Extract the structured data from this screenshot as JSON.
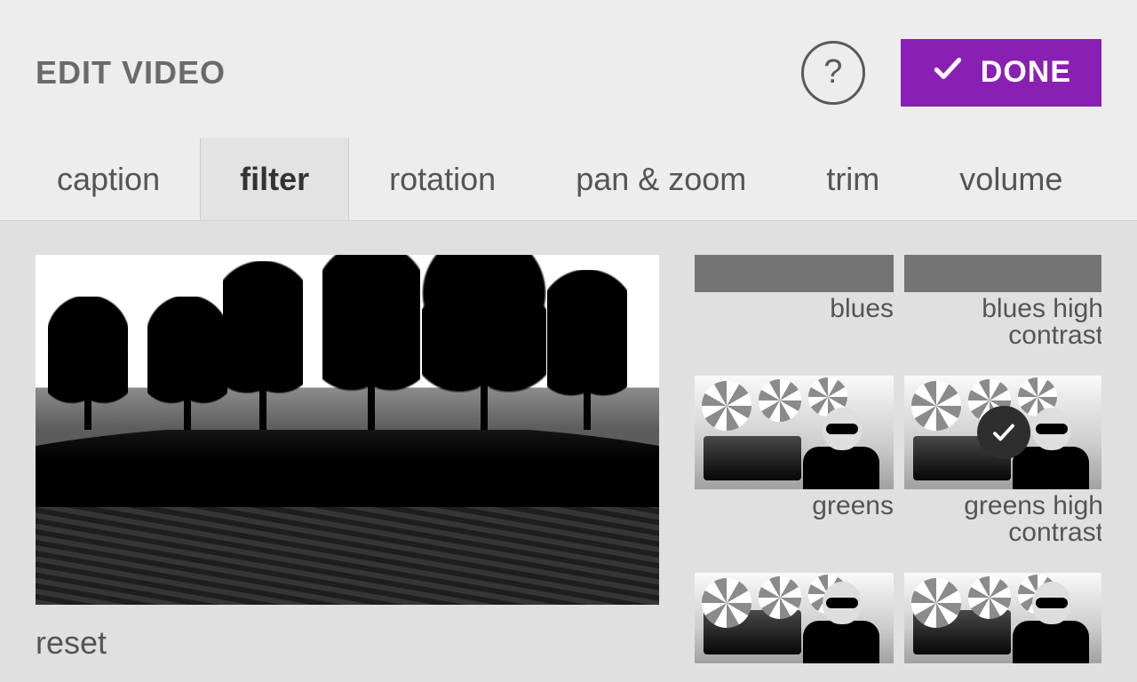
{
  "header": {
    "title": "EDIT VIDEO",
    "help_label": "?",
    "done_label": "DONE"
  },
  "tabs": [
    {
      "id": "caption",
      "label": "caption",
      "active": false
    },
    {
      "id": "filter",
      "label": "filter",
      "active": true
    },
    {
      "id": "rotation",
      "label": "rotation",
      "active": false
    },
    {
      "id": "panzoom",
      "label": "pan & zoom",
      "active": false
    },
    {
      "id": "trim",
      "label": "trim",
      "active": false
    },
    {
      "id": "volume",
      "label": "volume",
      "active": false
    }
  ],
  "preview": {
    "reset_label": "reset"
  },
  "filters": [
    {
      "id": "blues",
      "label": "blues",
      "selected": false,
      "crop": "top"
    },
    {
      "id": "blues-high-contrast",
      "label": "blues high contrast",
      "selected": false,
      "crop": "top"
    },
    {
      "id": "greens",
      "label": "greens",
      "selected": false,
      "crop": "full"
    },
    {
      "id": "greens-high-contrast",
      "label": "greens high contrast",
      "selected": true,
      "crop": "full"
    },
    {
      "id": "next-1",
      "label": "",
      "selected": false,
      "crop": "bottom"
    },
    {
      "id": "next-2",
      "label": "",
      "selected": false,
      "crop": "bottom"
    }
  ],
  "colors": {
    "accent": "#8a1fb3"
  }
}
